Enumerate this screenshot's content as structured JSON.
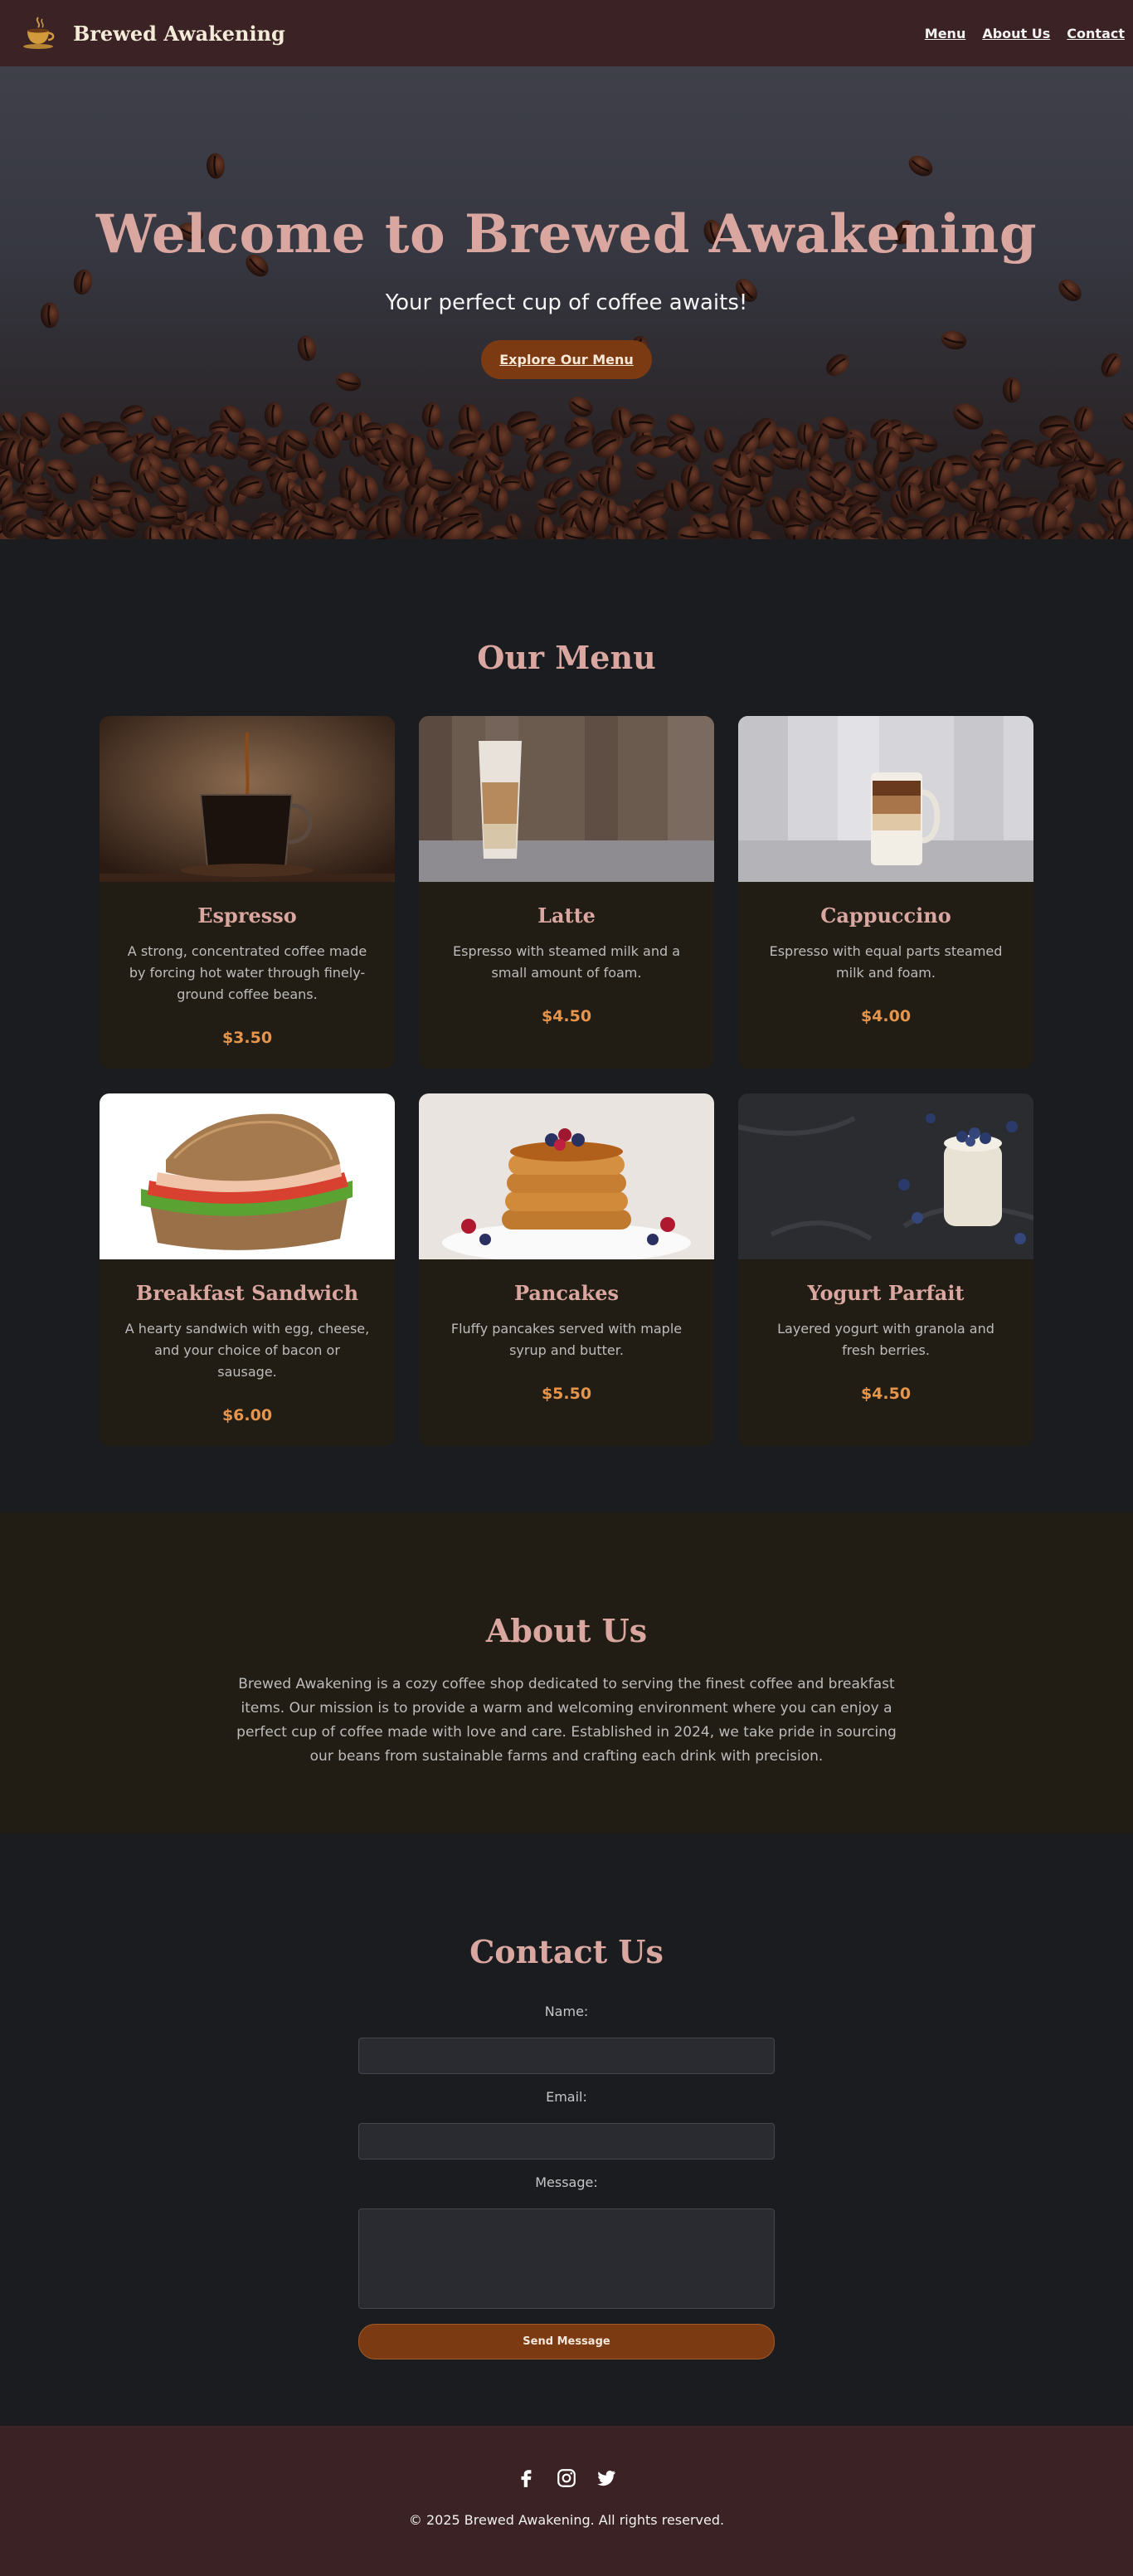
{
  "header": {
    "brand": "Brewed Awakening",
    "nav": [
      {
        "label": "Menu"
      },
      {
        "label": "About Us"
      },
      {
        "label": "Contact"
      }
    ]
  },
  "hero": {
    "title": "Welcome to Brewed Awakening",
    "subtitle": "Your perfect cup of coffee awaits!",
    "cta": "Explore Our Menu"
  },
  "menu": {
    "title": "Our Menu",
    "items": [
      {
        "name": "Espresso",
        "description": "A strong, concentrated coffee made by forcing hot water through finely-ground coffee beans.",
        "price": "$3.50"
      },
      {
        "name": "Latte",
        "description": "Espresso with steamed milk and a small amount of foam.",
        "price": "$4.50"
      },
      {
        "name": "Cappuccino",
        "description": "Espresso with equal parts steamed milk and foam.",
        "price": "$4.00"
      },
      {
        "name": "Breakfast Sandwich",
        "description": "A hearty sandwich with egg, cheese, and your choice of bacon or sausage.",
        "price": "$6.00"
      },
      {
        "name": "Pancakes",
        "description": "Fluffy pancakes served with maple syrup and butter.",
        "price": "$5.50"
      },
      {
        "name": "Yogurt Parfait",
        "description": "Layered yogurt with granola and fresh berries.",
        "price": "$4.50"
      }
    ]
  },
  "about": {
    "title": "About Us",
    "text": "Brewed Awakening is a cozy coffee shop dedicated to serving the finest coffee and breakfast items. Our mission is to provide a warm and welcoming environment where you can enjoy a perfect cup of coffee made with love and care. Established in 2024, we take pride in sourcing our beans from sustainable farms and crafting each drink with precision."
  },
  "contact": {
    "title": "Contact Us",
    "name_label": "Name:",
    "email_label": "Email:",
    "message_label": "Message:",
    "submit": "Send Message"
  },
  "footer": {
    "social_icons": [
      "facebook-icon",
      "instagram-icon",
      "twitter-icon"
    ],
    "copyright": "© 2025 Brewed Awakening. All rights reserved."
  },
  "colors": {
    "header_bg": "#3b2224",
    "accent": "#d9a6a0",
    "price": "#e6954c",
    "button": "#7b3a12"
  }
}
